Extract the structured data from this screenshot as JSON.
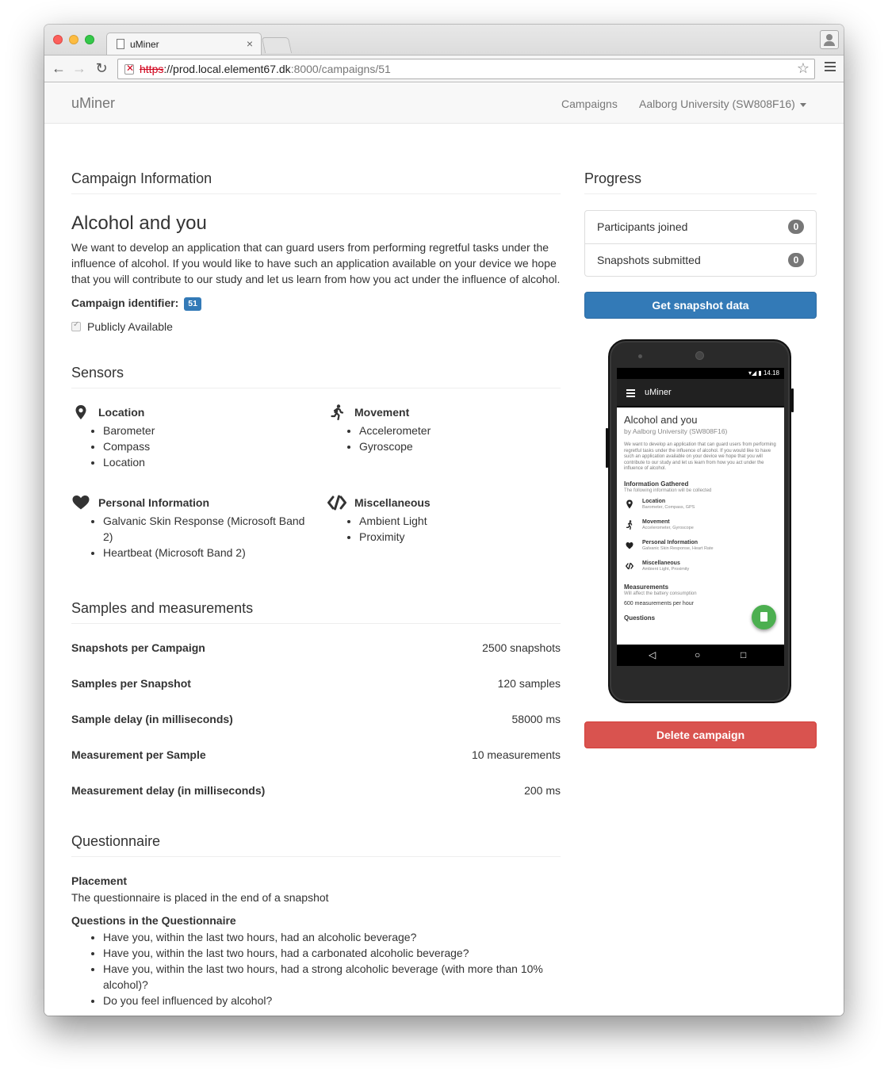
{
  "browser": {
    "tab_title": "uMiner",
    "tab_close": "×",
    "url_scheme": "https",
    "url_host": "://prod.local.element67.dk",
    "url_rest": ":8000/campaigns/51"
  },
  "navbar": {
    "brand": "uMiner",
    "campaigns_link": "Campaigns",
    "org_dropdown": "Aalborg University (SW808F16)"
  },
  "campaign_info": {
    "heading": "Campaign Information",
    "title": "Alcohol and you",
    "description": "We want to develop an application that can guard users from performing regretful tasks under the influence of alcohol. If you would like to have such an application available on your device we hope that you will contribute to our study and let us learn from how you act under the influence of alcohol.",
    "identifier_label": "Campaign identifier:",
    "identifier_value": "51",
    "public_label": "Publicly Available",
    "public_checked": true
  },
  "sensors": {
    "heading": "Sensors",
    "groups": [
      {
        "name": "Location",
        "icon": "map-pin-icon",
        "items": [
          "Barometer",
          "Compass",
          "Location"
        ]
      },
      {
        "name": "Movement",
        "icon": "running-person-icon",
        "items": [
          "Accelerometer",
          "Gyroscope"
        ]
      },
      {
        "name": "Personal Information",
        "icon": "heart-icon",
        "items": [
          "Galvanic Skin Response (Microsoft Band 2)",
          "Heartbeat (Microsoft Band 2)"
        ]
      },
      {
        "name": "Miscellaneous",
        "icon": "code-icon",
        "items": [
          "Ambient Light",
          "Proximity"
        ]
      }
    ]
  },
  "samples": {
    "heading": "Samples and measurements",
    "rows": [
      {
        "label": "Snapshots per Campaign",
        "value": "2500 snapshots"
      },
      {
        "label": "Samples per Snapshot",
        "value": "120 samples"
      },
      {
        "label": "Sample delay (in milliseconds)",
        "value": "58000 ms"
      },
      {
        "label": "Measurement per Sample",
        "value": "10 measurements"
      },
      {
        "label": "Measurement delay (in milliseconds)",
        "value": "200 ms"
      }
    ]
  },
  "questionnaire": {
    "heading": "Questionnaire",
    "placement_label": "Placement",
    "placement_text": "The questionnaire is placed in the end of a snapshot",
    "questions_label": "Questions in the Questionnaire",
    "questions": [
      "Have you, within the last two hours, had an alcoholic beverage?",
      "Have you, within the last two hours, had a carbonated alcoholic beverage?",
      "Have you, within the last two hours, had a strong alcoholic beverage (with more than 10% alcohol)?",
      "Do you feel influenced by alcohol?"
    ]
  },
  "progress": {
    "heading": "Progress",
    "items": [
      {
        "label": "Participants joined",
        "count": "0"
      },
      {
        "label": "Snapshots submitted",
        "count": "0"
      }
    ],
    "get_data_button": "Get snapshot data",
    "delete_button": "Delete campaign"
  },
  "phone_preview": {
    "status_time": "14.18",
    "app_title": "uMiner",
    "title": "Alcohol and you",
    "subtitle": "by Aalborg University (SW808F16)",
    "description": "We want to develop an application that can guard users from performing regretful tasks under the influence of alcohol. If you would like to have such an application available on your device we hope that you will contribute to our study and let us learn from how you act under the influence of alcohol.",
    "info_heading": "Information Gathered",
    "info_sub": "The following information will be collected",
    "items": [
      {
        "title": "Location",
        "sub": "Barometer, Compass, GPS"
      },
      {
        "title": "Movement",
        "sub": "Accelerometer, Gyroscope"
      },
      {
        "title": "Personal Information",
        "sub": "Galvanic Skin Response, Heart Rate"
      },
      {
        "title": "Miscellaneous",
        "sub": "Ambient Light, Proximity"
      }
    ],
    "measurements_heading": "Measurements",
    "measurements_sub": "Will affect the battery consumption",
    "measurements_value": "600 measurements per hour",
    "questions_heading": "Questions"
  },
  "colors": {
    "primary": "#337ab7",
    "danger": "#d9534f",
    "badge": "#777777",
    "fab": "#4caf50"
  }
}
